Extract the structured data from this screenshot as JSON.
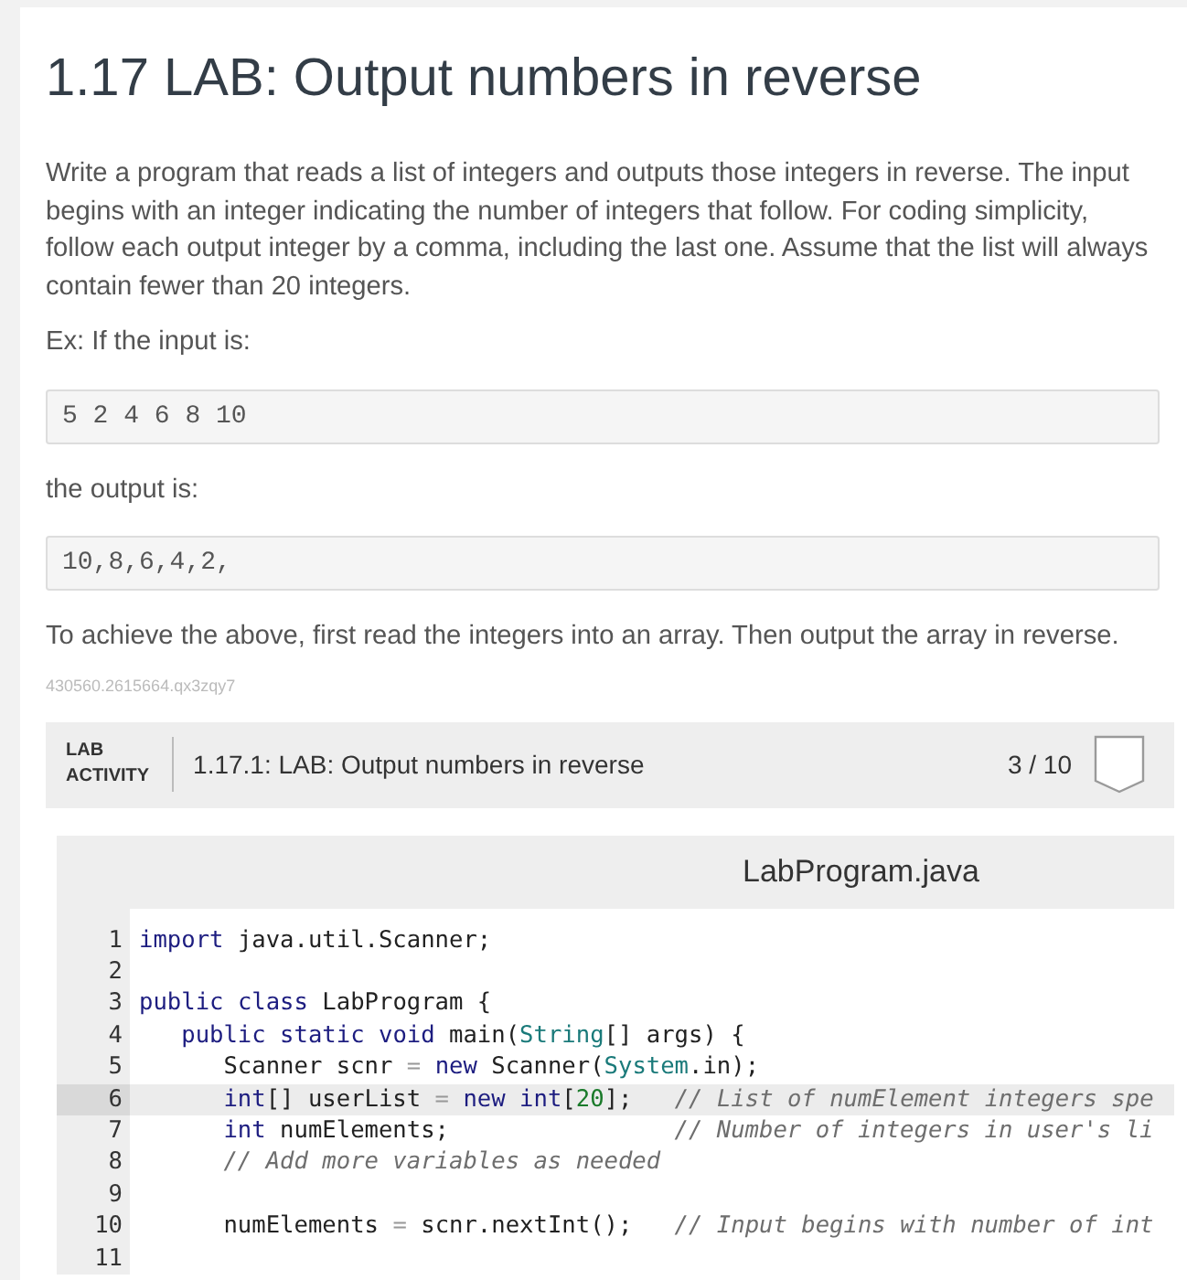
{
  "title": "1.17 LAB: Output numbers in reverse",
  "content": [
    {
      "kind": "paragraph",
      "text": "Write a program that reads a list of integers and outputs those integers in reverse. The input begins with an integer indicating the number of integers that follow. For coding simplicity, follow each output integer by a comma, including the last one. Assume that the list will always contain fewer than 20 integers."
    },
    {
      "kind": "paragraph",
      "text": "Ex: If the input is:"
    },
    {
      "kind": "sample",
      "text": "5 2 4 6 8 10"
    },
    {
      "kind": "paragraph",
      "text": "the output is:"
    },
    {
      "kind": "sample",
      "text": "10,8,6,4,2,"
    },
    {
      "kind": "paragraph",
      "text": "To achieve the above, first read the integers into an array. Then output the array in reverse."
    }
  ],
  "content_id": "430560.2615664.qx3zqy7",
  "lab_activity": {
    "label": "LAB ACTIVITY",
    "title": "1.17.1: LAB: Output numbers in reverse",
    "score": "3 / 10",
    "completed": false
  },
  "editor": {
    "filename": "LabProgram.java",
    "lines": [
      {
        "number": "1",
        "active": false,
        "tokens": [
          {
            "kind": "keyword",
            "text": "import"
          },
          {
            "kind": "plain",
            "text": " java.util.Scanner;"
          }
        ]
      },
      {
        "number": "2",
        "active": false
      },
      {
        "number": "3",
        "active": false,
        "tokens": [
          {
            "kind": "keyword",
            "text": "public"
          },
          {
            "kind": "keyword",
            "text": " class"
          },
          {
            "kind": "plain",
            "text": " LabProgram {"
          }
        ]
      },
      {
        "number": "4",
        "active": false,
        "tokens": [
          {
            "kind": "keyword",
            "text": "   public"
          },
          {
            "kind": "keyword",
            "text": " static"
          },
          {
            "kind": "keyword",
            "text": " void"
          },
          {
            "kind": "plain",
            "text": " main("
          },
          {
            "kind": "type",
            "text": "String"
          },
          {
            "kind": "plain",
            "text": "[] args) {"
          }
        ]
      },
      {
        "number": "5",
        "active": false,
        "tokens": [
          {
            "kind": "plain",
            "text": "      Scanner scnr "
          },
          {
            "kind": "operator",
            "text": "="
          },
          {
            "kind": "keyword",
            "text": " new"
          },
          {
            "kind": "plain",
            "text": " Scanner("
          },
          {
            "kind": "type",
            "text": "System"
          },
          {
            "kind": "plain",
            "text": ".in);"
          }
        ]
      },
      {
        "number": "6",
        "active": true,
        "tokens": [
          {
            "kind": "keyword",
            "text": "      int"
          },
          {
            "kind": "plain",
            "text": "[] userList "
          },
          {
            "kind": "operator",
            "text": "="
          },
          {
            "kind": "keyword",
            "text": " new"
          },
          {
            "kind": "keyword",
            "text": " int"
          },
          {
            "kind": "plain",
            "text": "["
          },
          {
            "kind": "number",
            "text": "20"
          },
          {
            "kind": "plain",
            "text": "];   "
          },
          {
            "kind": "comment",
            "text": "// List of numElement integers spe"
          }
        ]
      },
      {
        "number": "7",
        "active": false,
        "tokens": [
          {
            "kind": "keyword",
            "text": "      int"
          },
          {
            "kind": "plain",
            "text": " numElements;                "
          },
          {
            "kind": "comment",
            "text": "// Number of integers in user's li"
          }
        ]
      },
      {
        "number": "8",
        "active": false,
        "tokens": [
          {
            "kind": "comment",
            "text": "      // Add more variables as needed"
          }
        ]
      },
      {
        "number": "9",
        "active": false
      },
      {
        "number": "10",
        "active": false,
        "tokens": [
          {
            "kind": "plain",
            "text": "      numElements "
          },
          {
            "kind": "operator",
            "text": "="
          },
          {
            "kind": "plain",
            "text": " scnr.nextInt();   "
          },
          {
            "kind": "comment",
            "text": "// Input begins with number of int"
          }
        ]
      },
      {
        "number": "11",
        "active": false
      }
    ]
  }
}
